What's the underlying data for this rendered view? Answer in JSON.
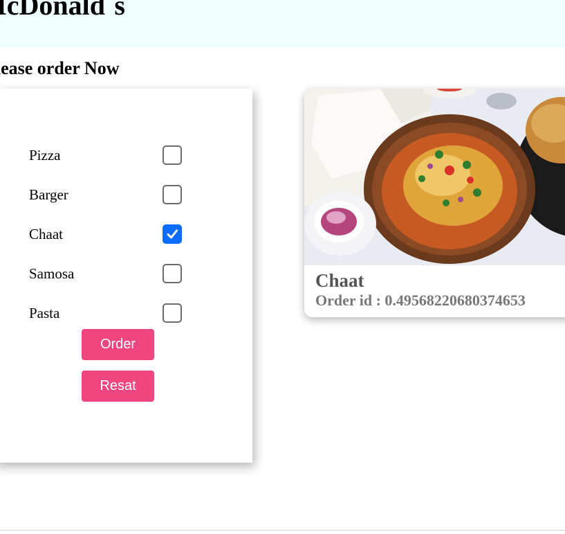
{
  "header": {
    "brand": "McDonald´s",
    "background": "#effeff"
  },
  "subtitle": "Please order Now",
  "menu": {
    "items": [
      {
        "label": "Pizza",
        "checked": false
      },
      {
        "label": "Barger",
        "checked": false
      },
      {
        "label": "Chaat",
        "checked": true
      },
      {
        "label": "Samosa",
        "checked": false
      },
      {
        "label": "Pasta",
        "checked": false
      }
    ],
    "order_label": "Order",
    "reset_label": "Resat",
    "button_color": "#f0467e",
    "check_color": "#0b6cff"
  },
  "card": {
    "title": "Chaat",
    "order_id": "Order id : 0.49568220680374653",
    "image_icon": "food-bowl-photo"
  }
}
